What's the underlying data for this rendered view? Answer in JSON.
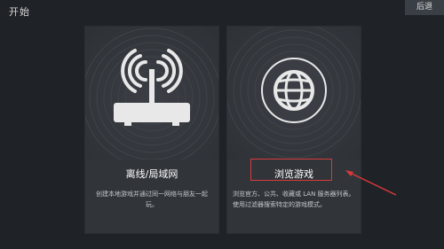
{
  "header": {
    "title": "开始",
    "back_label": "后退"
  },
  "cards": [
    {
      "title": "离线/局域网",
      "description": "创建本地游戏并通过同一网络与朋友一起玩。",
      "icon": "wifi-router-icon"
    },
    {
      "title": "浏览游戏",
      "description": "浏览官方、公共、收藏或 LAN 服务器列表。使用过滤器搜索特定的游戏模式。",
      "icon": "globe-icon"
    }
  ],
  "annotation": {
    "highlight_color": "#d83a3a",
    "arrow_color": "#d83a3a"
  },
  "colors": {
    "background": "#1f2226",
    "card": "#31353a"
  }
}
